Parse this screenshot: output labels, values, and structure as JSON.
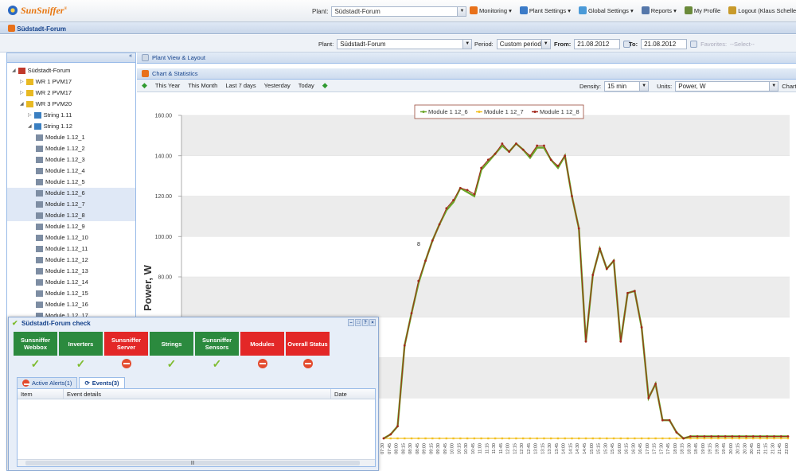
{
  "app": {
    "logo": "SunSniffer",
    "tm": "®"
  },
  "top": {
    "plant_label": "Plant:",
    "plant_value": "Südstadt-Forum",
    "menu": [
      {
        "label": "Monitoring ▾",
        "icon": "bar-chart-icon"
      },
      {
        "label": "Plant Settings ▾",
        "icon": "plant-settings-icon"
      },
      {
        "label": "Global Settings ▾",
        "icon": "global-settings-icon"
      },
      {
        "label": "Reports ▾",
        "icon": "reports-icon"
      },
      {
        "label": "My Profile",
        "icon": "profile-icon"
      },
      {
        "label": "Logout (Klaus Scheller)",
        "icon": "logout-icon"
      }
    ]
  },
  "page_title": "Südstadt-Forum",
  "filter": {
    "plant_label": "Plant:",
    "plant_value": "Südstadt-Forum",
    "period_label": "Period:",
    "period_value": "Custom period",
    "from_label": "From:",
    "from_value": "21.08.2012",
    "to_label": "To:",
    "to_value": "21.08.2012",
    "favorites_label": "Favorites:",
    "favorites_value": "--Select--"
  },
  "tree": [
    {
      "label": "Südstadt-Forum",
      "indent": 0,
      "sel": false
    },
    {
      "label": "WR 1 PVM17",
      "indent": 1,
      "sel": false
    },
    {
      "label": "WR 2 PVM17",
      "indent": 1,
      "sel": false
    },
    {
      "label": "WR 3 PVM20",
      "indent": 1,
      "sel": false
    },
    {
      "label": "String 1.11",
      "indent": 2,
      "sel": false
    },
    {
      "label": "String 1.12",
      "indent": 2,
      "sel": false
    },
    {
      "label": "Module 1.12_1",
      "indent": 3,
      "sel": false
    },
    {
      "label": "Module 1.12_2",
      "indent": 3,
      "sel": false
    },
    {
      "label": "Module 1.12_3",
      "indent": 3,
      "sel": false
    },
    {
      "label": "Module 1.12_4",
      "indent": 3,
      "sel": false
    },
    {
      "label": "Module 1.12_5",
      "indent": 3,
      "sel": false
    },
    {
      "label": "Module 1.12_6",
      "indent": 3,
      "sel": true
    },
    {
      "label": "Module 1.12_7",
      "indent": 3,
      "sel": true
    },
    {
      "label": "Module 1.12_8",
      "indent": 3,
      "sel": true
    },
    {
      "label": "Module 1.12_9",
      "indent": 3,
      "sel": false
    },
    {
      "label": "Module 1.12_10",
      "indent": 3,
      "sel": false
    },
    {
      "label": "Module 1.12_11",
      "indent": 3,
      "sel": false
    },
    {
      "label": "Module 1.12_12",
      "indent": 3,
      "sel": false
    },
    {
      "label": "Module 1.12_13",
      "indent": 3,
      "sel": false
    },
    {
      "label": "Module 1.12_14",
      "indent": 3,
      "sel": false
    },
    {
      "label": "Module 1.12_15",
      "indent": 3,
      "sel": false
    },
    {
      "label": "Module 1.12_16",
      "indent": 3,
      "sel": false
    },
    {
      "label": "Module 1.12_17",
      "indent": 3,
      "sel": false
    }
  ],
  "panels": {
    "plant_view": "Plant View & Layout",
    "chart_stats": "Chart & Statistics"
  },
  "chartbar": {
    "ranges": [
      "This Year",
      "This Month",
      "Last 7 days",
      "Yesterday",
      "Today"
    ],
    "density_label": "Density:",
    "density_value": "15 min",
    "units_label": "Units:",
    "units_value": "Power, W",
    "chart_label": "Chart:"
  },
  "chart_data": {
    "type": "line",
    "ylabel": "Power, W",
    "ylim": [
      0,
      160
    ],
    "yticks": [
      "160.00",
      "140.00",
      "120.00",
      "100.00",
      "80.00"
    ],
    "stray_label": "8",
    "x": [
      "07:30",
      "07:45",
      "08:00",
      "08:15",
      "08:30",
      "08:45",
      "09:00",
      "09:15",
      "09:30",
      "09:45",
      "10:00",
      "10:15",
      "10:30",
      "10:45",
      "11:00",
      "11:15",
      "11:30",
      "11:45",
      "12:00",
      "12:15",
      "12:30",
      "12:45",
      "13:00",
      "13:15",
      "13:30",
      "13:45",
      "14:00",
      "14:15",
      "14:30",
      "14:45",
      "15:00",
      "15:15",
      "15:30",
      "15:45",
      "16:00",
      "16:15",
      "16:30",
      "16:45",
      "17:00",
      "17:15",
      "17:30",
      "17:45",
      "18:00",
      "18:15",
      "18:30",
      "18:45",
      "19:00",
      "19:15",
      "19:30",
      "19:45",
      "20:00",
      "20:15",
      "20:30",
      "20:45",
      "21:00",
      "21:15",
      "21:30",
      "21:45",
      "22:00"
    ],
    "series": [
      {
        "name": "Module 1 12_6",
        "color": "#6aa528",
        "values": [
          0,
          2,
          6,
          46,
          62,
          77,
          88,
          98,
          106,
          113,
          117,
          124,
          122,
          120,
          133,
          137,
          141,
          145,
          142,
          146,
          143,
          139,
          144,
          144,
          138,
          134,
          140,
          120,
          104,
          48,
          81,
          94,
          84,
          88,
          48,
          72,
          73,
          55,
          20,
          27,
          9,
          9,
          3,
          0,
          1,
          1,
          1,
          1,
          1,
          1,
          1,
          1,
          1,
          1,
          1,
          1,
          1,
          1,
          1
        ]
      },
      {
        "name": "Module 1 12_7",
        "color": "#f2c023",
        "values": [
          0,
          0,
          0,
          0,
          0,
          0,
          0,
          0,
          0,
          0,
          0,
          0,
          0,
          0,
          0,
          0,
          0,
          0,
          0,
          0,
          0,
          0,
          0,
          0,
          0,
          0,
          0,
          0,
          0,
          0,
          0,
          0,
          0,
          0,
          0,
          0,
          0,
          0,
          0,
          0,
          0,
          0,
          0,
          0,
          0,
          0,
          0,
          0,
          0,
          0,
          0,
          0,
          0,
          0,
          0,
          0,
          0,
          0,
          0
        ]
      },
      {
        "name": "Module 1 12_8",
        "color": "#a3281c",
        "values": [
          0,
          2,
          6,
          46,
          62,
          78,
          88,
          98,
          106,
          114,
          118,
          124,
          123,
          121,
          134,
          138,
          141,
          146,
          142,
          146,
          143,
          140,
          145,
          145,
          138,
          135,
          140,
          120,
          104,
          48,
          81,
          94,
          84,
          88,
          48,
          72,
          73,
          55,
          20,
          27,
          9,
          9,
          3,
          0,
          1,
          1,
          1,
          1,
          1,
          1,
          1,
          1,
          1,
          1,
          1,
          1,
          1,
          1,
          1
        ]
      }
    ]
  },
  "dialog": {
    "title": "Südstadt-Forum check",
    "checks": [
      {
        "label": "Sunsniffer Webbox",
        "ok": true
      },
      {
        "label": "Inverters",
        "ok": true
      },
      {
        "label": "Sunsniffer Server",
        "ok": false
      },
      {
        "label": "Strings",
        "ok": true
      },
      {
        "label": "Sunsniffer Sensors",
        "ok": true
      },
      {
        "label": "Modules",
        "ok": false
      },
      {
        "label": "Overall Status",
        "ok": false
      }
    ],
    "tab_alerts": "Active Alerts(1)",
    "tab_events": "Events(3)",
    "col_item": "Item",
    "col_details": "Event details",
    "col_date": "Date"
  }
}
